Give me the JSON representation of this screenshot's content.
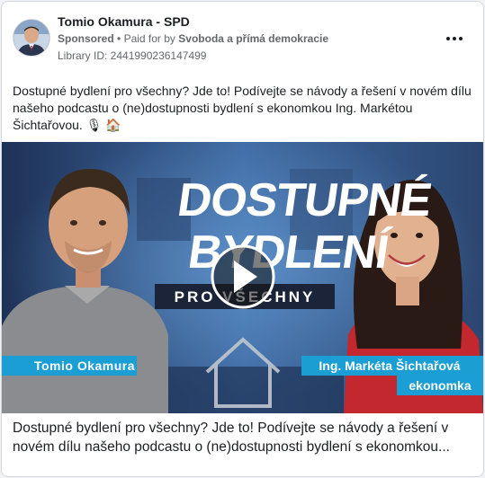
{
  "post": {
    "page_name": "Tomio Okamura - SPD",
    "sponsored_label": "Sponsored",
    "paid_for_prefix": "Paid for by",
    "payer": "Svoboda a přímá demokracie",
    "separator": "•",
    "library_id": "Library ID: 2441990236147499",
    "body_text": "Dostupné bydlení pro všechny? Jde to! Podívejte se návody a řešení v novém dílu našeho podcastu o (ne)dostupnosti bydlení s ekonomkou Ing. Markétou Šichtařovou. 🎙 🏠",
    "more_icon": "ellipsis-icon"
  },
  "thumbnail": {
    "title_line1": "DOSTUPNÉ",
    "title_line2": "BYDLENÍ",
    "subtitle": "PRO VŠECHNY",
    "left_name": "Tomio Okamura",
    "right_name": "Ing. Markéta Šichtařová",
    "right_role": "ekonomka",
    "play_icon": "play-icon",
    "house_icon": "house-icon",
    "accent_color": "#1a9ed4"
  },
  "caption": {
    "line1": "Dostupné bydlení pro všechny? Jde to! Podívejte se návody a řešení v",
    "line2": "novém dílu našeho podcastu o (ne)dostupnosti bydlení s ekonomkou..."
  }
}
